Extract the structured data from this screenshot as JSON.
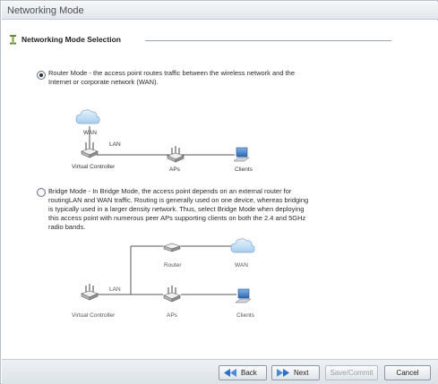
{
  "window": {
    "title": "Networking Mode"
  },
  "section": {
    "title": "Networking Mode Selection"
  },
  "router_option": {
    "selected": true,
    "text_line1": "Router Mode - the access point routes traffic between the wireless network and the",
    "text_line2": "Internet or corporate network (WAN)."
  },
  "router_diagram": {
    "wan_label": "WAN",
    "lan_label": "LAN",
    "controller_label": "Virtual Controller",
    "aps_label": "APs",
    "clients_label": "Clients"
  },
  "bridge_option": {
    "selected": false,
    "text_line1": "Bridge Mode - In Bridge Mode, the access point depends on an external router for",
    "text_line2": "routingLAN and WAN traffic. Routing is generally used on one device, whereas bridging",
    "text_line3": "is typically used in a larger density network. Thus, select Bridge Mode when deploying",
    "text_line4": "this access point with numerous peer APs supporting clients on both the 2.4 and 5GHz",
    "text_line5": "radio bands."
  },
  "bridge_diagram": {
    "router_label": "Router",
    "wan_label": "WAN",
    "lan_label": "LAN",
    "controller_label": "Virtual Controller",
    "aps_label": "APs",
    "clients_label": "Clients"
  },
  "footer": {
    "back_label": "Back",
    "next_label": "Next",
    "save_label": "Save/Commit",
    "cancel_label": "Cancel"
  },
  "colors": {
    "accent": "#2f6fc4",
    "line": "#555555",
    "header_bg": "#e3e7eb"
  }
}
